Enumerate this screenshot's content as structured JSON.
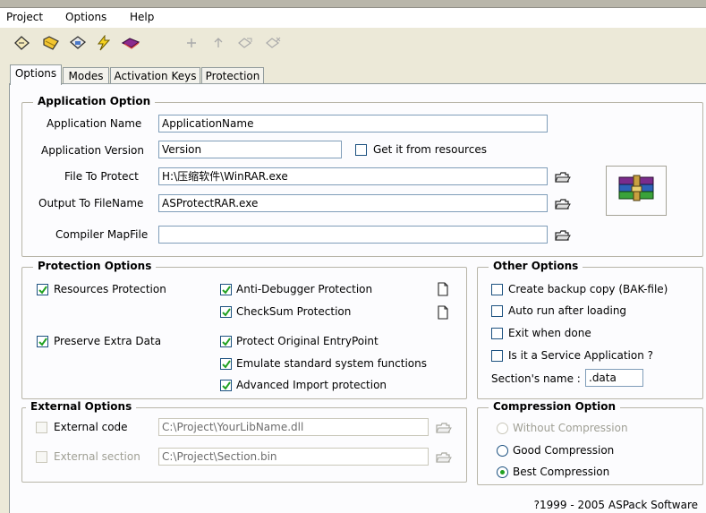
{
  "menu": {
    "project": "Project",
    "options": "Options",
    "help": "Help"
  },
  "toolbar": {
    "icons": [
      "new-icon",
      "open-icon",
      "save-icon",
      "protect-icon",
      "book-icon",
      "add-icon",
      "remove-icon",
      "import-icon",
      "export-icon"
    ]
  },
  "tabs": [
    "Options",
    "Modes",
    "Activation Keys",
    "Protection"
  ],
  "app_option": {
    "title": "Application Option",
    "name_label": "Application Name",
    "name_value": "ApplicationName",
    "version_label": "Application Version",
    "version_value": "Version",
    "get_from_resources": "Get it from resources",
    "file_label": "File To Protect",
    "file_value": "H:\\压缩软件\\WinRAR.exe",
    "output_label": "Output To FileName",
    "output_value": "ASProtectRAR.exe",
    "map_label": "Compiler MapFile",
    "map_value": ""
  },
  "protection": {
    "title": "Protection Options",
    "items": [
      {
        "label": "Resources Protection",
        "checked": true
      },
      {
        "label": "Anti-Debugger Protection",
        "checked": true
      },
      {
        "label": "CheckSum Protection",
        "checked": true
      },
      {
        "label": "Preserve Extra Data",
        "checked": true
      },
      {
        "label": "Protect Original EntryPoint",
        "checked": true
      },
      {
        "label": "Emulate standard system functions",
        "checked": true
      },
      {
        "label": "Advanced Import protection",
        "checked": true
      }
    ]
  },
  "other": {
    "title": "Other Options",
    "backup": "Create backup copy (BAK-file)",
    "autorun": "Auto run after loading",
    "exit": "Exit when done",
    "service": "Is it a Service Application ?",
    "section_label": "Section's name :",
    "section_value": ".data"
  },
  "external": {
    "title": "External Options",
    "code_label": "External code",
    "code_value": "C:\\Project\\YourLibName.dll",
    "section_label": "External section",
    "section_value": "C:\\Project\\Section.bin"
  },
  "compression": {
    "title": "Compression Option",
    "options": [
      {
        "label": "Without Compression",
        "selected": false,
        "enabled": false
      },
      {
        "label": "Good Compression",
        "selected": false,
        "enabled": true
      },
      {
        "label": "Best Compression",
        "selected": true,
        "enabled": true
      }
    ]
  },
  "footer": "?1999 - 2005   ASPack Software",
  "colors": {
    "window_bg": "#ece9d8",
    "panel_bg": "#fcfcfe",
    "input_border": "#7f9db9",
    "check_green": "#21a121"
  }
}
